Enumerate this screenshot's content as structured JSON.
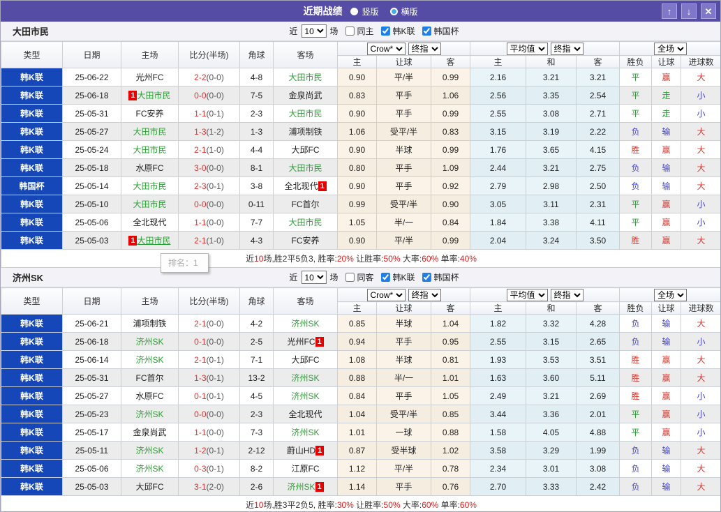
{
  "title_bar": {
    "title": "近期战绩",
    "radios": [
      {
        "label": "竖版",
        "selected": true
      },
      {
        "label": "横版",
        "selected": false
      }
    ],
    "up_icon": "↑",
    "down_icon": "↓",
    "close_icon": "✕"
  },
  "colors": {
    "titlebar_purple": "#554CA6",
    "type_cell_blue": "#1547B8",
    "focus_team_green": "#2E9E36",
    "score_red": "#E03131",
    "result_red": "#D63B32",
    "result_blue": "#4545CF",
    "result_green": "#2E9E36",
    "badge_red": "#E60000",
    "odds_cell_cream": "#FBF3E8",
    "avg_cell_blue": "#E9F4F9"
  },
  "columns": {
    "type": "类型",
    "date": "日期",
    "home": "主场",
    "score": "比分(半场)",
    "corner": "角球",
    "away": "客场",
    "odds_selects": [
      "Crow*",
      "终指"
    ],
    "avg_selects": [
      "平均值",
      "终指"
    ],
    "result_selects": [
      "全场"
    ],
    "odds_sub": [
      "主",
      "让球",
      "客"
    ],
    "avg_sub": [
      "主",
      "和",
      "客"
    ],
    "result_sub": [
      "胜负",
      "让球",
      "进球数"
    ]
  },
  "tooltip": {
    "text": "排名：1"
  },
  "sections": [
    {
      "team": "大田市民",
      "filter": {
        "near": "近",
        "count": "10",
        "unit": "场",
        "same": "同主",
        "same_checked": false,
        "leagues": [
          {
            "label": "韩K联",
            "checked": true
          },
          {
            "label": "韩国杯",
            "checked": true
          }
        ]
      },
      "rows": [
        {
          "type": "韩K联",
          "date": "25-06-22",
          "home": {
            "name": "光州FC"
          },
          "score": [
            "2-2",
            "(0-0)"
          ],
          "corner": "4-8",
          "away": {
            "name": "大田市民",
            "focus": true
          },
          "odds": [
            "0.90",
            "平/半",
            "0.99"
          ],
          "avg": [
            "2.16",
            "3.21",
            "3.21"
          ],
          "res": [
            [
              "平",
              "g"
            ],
            [
              "赢",
              "r"
            ],
            [
              "大",
              "r"
            ]
          ]
        },
        {
          "type": "韩K联",
          "date": "25-06-18",
          "home": {
            "name": "大田市民",
            "focus": true,
            "badge": "1",
            "badge_pos": "before"
          },
          "score": [
            "0-0",
            "(0-0)"
          ],
          "corner": "7-5",
          "away": {
            "name": "金泉尚武"
          },
          "odds": [
            "0.83",
            "平手",
            "1.06"
          ],
          "avg": [
            "2.56",
            "3.35",
            "2.54"
          ],
          "res": [
            [
              "平",
              "g"
            ],
            [
              "走",
              "g"
            ],
            [
              "小",
              "b"
            ]
          ]
        },
        {
          "type": "韩K联",
          "date": "25-05-31",
          "home": {
            "name": "FC安养"
          },
          "score": [
            "1-1",
            "(0-1)"
          ],
          "corner": "2-3",
          "away": {
            "name": "大田市民",
            "focus": true
          },
          "odds": [
            "0.90",
            "平手",
            "0.99"
          ],
          "avg": [
            "2.55",
            "3.08",
            "2.71"
          ],
          "res": [
            [
              "平",
              "g"
            ],
            [
              "走",
              "g"
            ],
            [
              "小",
              "b"
            ]
          ]
        },
        {
          "type": "韩K联",
          "date": "25-05-27",
          "home": {
            "name": "大田市民",
            "focus": true
          },
          "score": [
            "1-3",
            "(1-2)"
          ],
          "corner": "1-3",
          "away": {
            "name": "浦项制铁"
          },
          "odds": [
            "1.06",
            "受平/半",
            "0.83"
          ],
          "avg": [
            "3.15",
            "3.19",
            "2.22"
          ],
          "res": [
            [
              "负",
              "b"
            ],
            [
              "输",
              "b"
            ],
            [
              "大",
              "r"
            ]
          ]
        },
        {
          "type": "韩K联",
          "date": "25-05-24",
          "home": {
            "name": "大田市民",
            "focus": true
          },
          "score": [
            "2-1",
            "(1-0)"
          ],
          "corner": "4-4",
          "away": {
            "name": "大邱FC"
          },
          "odds": [
            "0.90",
            "半球",
            "0.99"
          ],
          "avg": [
            "1.76",
            "3.65",
            "4.15"
          ],
          "res": [
            [
              "胜",
              "r"
            ],
            [
              "赢",
              "r"
            ],
            [
              "大",
              "r"
            ]
          ]
        },
        {
          "type": "韩K联",
          "date": "25-05-18",
          "home": {
            "name": "水原FC"
          },
          "score": [
            "3-0",
            "(0-0)"
          ],
          "corner": "8-1",
          "away": {
            "name": "大田市民",
            "focus": true
          },
          "odds": [
            "0.80",
            "平手",
            "1.09"
          ],
          "avg": [
            "2.44",
            "3.21",
            "2.75"
          ],
          "res": [
            [
              "负",
              "b"
            ],
            [
              "输",
              "b"
            ],
            [
              "大",
              "r"
            ]
          ]
        },
        {
          "type": "韩国杯",
          "date": "25-05-14",
          "home": {
            "name": "大田市民",
            "focus": true
          },
          "score": [
            "2-3",
            "(0-1)"
          ],
          "corner": "3-8",
          "away": {
            "name": "全北现代",
            "badge": "1",
            "badge_pos": "after"
          },
          "odds": [
            "0.90",
            "平手",
            "0.92"
          ],
          "avg": [
            "2.79",
            "2.98",
            "2.50"
          ],
          "res": [
            [
              "负",
              "b"
            ],
            [
              "输",
              "b"
            ],
            [
              "大",
              "r"
            ]
          ]
        },
        {
          "type": "韩K联",
          "date": "25-05-10",
          "home": {
            "name": "大田市民",
            "focus": true
          },
          "score": [
            "0-0",
            "(0-0)"
          ],
          "corner": "0-11",
          "away": {
            "name": "FC首尔"
          },
          "odds": [
            "0.99",
            "受平/半",
            "0.90"
          ],
          "avg": [
            "3.05",
            "3.11",
            "2.31"
          ],
          "res": [
            [
              "平",
              "g"
            ],
            [
              "赢",
              "r"
            ],
            [
              "小",
              "b"
            ]
          ]
        },
        {
          "type": "韩K联",
          "date": "25-05-06",
          "home": {
            "name": "全北现代"
          },
          "score": [
            "1-1",
            "(0-0)"
          ],
          "corner": "7-7",
          "away": {
            "name": "大田市民",
            "focus": true
          },
          "odds": [
            "1.05",
            "半/一",
            "0.84"
          ],
          "avg": [
            "1.84",
            "3.38",
            "4.11"
          ],
          "res": [
            [
              "平",
              "g"
            ],
            [
              "赢",
              "r"
            ],
            [
              "小",
              "b"
            ]
          ]
        },
        {
          "type": "韩K联",
          "date": "25-05-03",
          "home": {
            "name": "大田市民",
            "focus": true,
            "badge": "1",
            "badge_pos": "before",
            "hover": true
          },
          "score": [
            "2-1",
            "(1-0)"
          ],
          "corner": "4-3",
          "away": {
            "name": "FC安养"
          },
          "odds": [
            "0.90",
            "平/半",
            "0.99"
          ],
          "avg": [
            "2.04",
            "3.24",
            "3.50"
          ],
          "res": [
            [
              "胜",
              "r"
            ],
            [
              "赢",
              "r"
            ],
            [
              "大",
              "r"
            ]
          ]
        }
      ],
      "summary": [
        {
          "t": "近"
        },
        {
          "t": "10",
          "red": true
        },
        {
          "t": "场,胜2平5负3, 胜率:"
        },
        {
          "t": "20%",
          "red": true
        },
        {
          "t": " 让胜率:"
        },
        {
          "t": "50%",
          "red": true
        },
        {
          "t": " 大率:"
        },
        {
          "t": "60%",
          "red": true
        },
        {
          "t": " 单率:"
        },
        {
          "t": "40%",
          "red": true
        }
      ]
    },
    {
      "team": "济州SK",
      "filter": {
        "near": "近",
        "count": "10",
        "unit": "场",
        "same": "同客",
        "same_checked": false,
        "leagues": [
          {
            "label": "韩K联",
            "checked": true
          },
          {
            "label": "韩国杯",
            "checked": true
          }
        ]
      },
      "rows": [
        {
          "type": "韩K联",
          "date": "25-06-21",
          "home": {
            "name": "浦项制铁"
          },
          "score": [
            "2-1",
            "(0-0)"
          ],
          "corner": "4-2",
          "away": {
            "name": "济州SK",
            "focus": true
          },
          "odds": [
            "0.85",
            "半球",
            "1.04"
          ],
          "avg": [
            "1.82",
            "3.32",
            "4.28"
          ],
          "res": [
            [
              "负",
              "b"
            ],
            [
              "输",
              "b"
            ],
            [
              "大",
              "r"
            ]
          ]
        },
        {
          "type": "韩K联",
          "date": "25-06-18",
          "home": {
            "name": "济州SK",
            "focus": true
          },
          "score": [
            "0-1",
            "(0-0)"
          ],
          "corner": "2-5",
          "away": {
            "name": "光州FC",
            "badge": "1",
            "badge_pos": "after"
          },
          "odds": [
            "0.94",
            "平手",
            "0.95"
          ],
          "avg": [
            "2.55",
            "3.15",
            "2.65"
          ],
          "res": [
            [
              "负",
              "b"
            ],
            [
              "输",
              "b"
            ],
            [
              "小",
              "b"
            ]
          ]
        },
        {
          "type": "韩K联",
          "date": "25-06-14",
          "home": {
            "name": "济州SK",
            "focus": true
          },
          "score": [
            "2-1",
            "(0-1)"
          ],
          "corner": "7-1",
          "away": {
            "name": "大邱FC"
          },
          "odds": [
            "1.08",
            "半球",
            "0.81"
          ],
          "avg": [
            "1.93",
            "3.53",
            "3.51"
          ],
          "res": [
            [
              "胜",
              "r"
            ],
            [
              "赢",
              "r"
            ],
            [
              "大",
              "r"
            ]
          ]
        },
        {
          "type": "韩K联",
          "date": "25-05-31",
          "home": {
            "name": "FC首尔"
          },
          "score": [
            "1-3",
            "(0-1)"
          ],
          "corner": "13-2",
          "away": {
            "name": "济州SK",
            "focus": true
          },
          "odds": [
            "0.88",
            "半/一",
            "1.01"
          ],
          "avg": [
            "1.63",
            "3.60",
            "5.11"
          ],
          "res": [
            [
              "胜",
              "r"
            ],
            [
              "赢",
              "r"
            ],
            [
              "大",
              "r"
            ]
          ]
        },
        {
          "type": "韩K联",
          "date": "25-05-27",
          "home": {
            "name": "水原FC"
          },
          "score": [
            "0-1",
            "(0-1)"
          ],
          "corner": "4-5",
          "away": {
            "name": "济州SK",
            "focus": true
          },
          "odds": [
            "0.84",
            "平手",
            "1.05"
          ],
          "avg": [
            "2.49",
            "3.21",
            "2.69"
          ],
          "res": [
            [
              "胜",
              "r"
            ],
            [
              "赢",
              "r"
            ],
            [
              "小",
              "b"
            ]
          ]
        },
        {
          "type": "韩K联",
          "date": "25-05-23",
          "home": {
            "name": "济州SK",
            "focus": true
          },
          "score": [
            "0-0",
            "(0-0)"
          ],
          "corner": "2-3",
          "away": {
            "name": "全北现代"
          },
          "odds": [
            "1.04",
            "受平/半",
            "0.85"
          ],
          "avg": [
            "3.44",
            "3.36",
            "2.01"
          ],
          "res": [
            [
              "平",
              "g"
            ],
            [
              "赢",
              "r"
            ],
            [
              "小",
              "b"
            ]
          ]
        },
        {
          "type": "韩K联",
          "date": "25-05-17",
          "home": {
            "name": "金泉尚武"
          },
          "score": [
            "1-1",
            "(0-0)"
          ],
          "corner": "7-3",
          "away": {
            "name": "济州SK",
            "focus": true
          },
          "odds": [
            "1.01",
            "一球",
            "0.88"
          ],
          "avg": [
            "1.58",
            "4.05",
            "4.88"
          ],
          "res": [
            [
              "平",
              "g"
            ],
            [
              "赢",
              "r"
            ],
            [
              "小",
              "b"
            ]
          ]
        },
        {
          "type": "韩K联",
          "date": "25-05-11",
          "home": {
            "name": "济州SK",
            "focus": true
          },
          "score": [
            "1-2",
            "(0-1)"
          ],
          "corner": "2-12",
          "away": {
            "name": "蔚山HD",
            "badge": "1",
            "badge_pos": "after"
          },
          "odds": [
            "0.87",
            "受半球",
            "1.02"
          ],
          "avg": [
            "3.58",
            "3.29",
            "1.99"
          ],
          "res": [
            [
              "负",
              "b"
            ],
            [
              "输",
              "b"
            ],
            [
              "大",
              "r"
            ]
          ]
        },
        {
          "type": "韩K联",
          "date": "25-05-06",
          "home": {
            "name": "济州SK",
            "focus": true
          },
          "score": [
            "0-3",
            "(0-1)"
          ],
          "corner": "8-2",
          "away": {
            "name": "江原FC"
          },
          "odds": [
            "1.12",
            "平/半",
            "0.78"
          ],
          "avg": [
            "2.34",
            "3.01",
            "3.08"
          ],
          "res": [
            [
              "负",
              "b"
            ],
            [
              "输",
              "b"
            ],
            [
              "大",
              "r"
            ]
          ]
        },
        {
          "type": "韩K联",
          "date": "25-05-03",
          "home": {
            "name": "大邱FC"
          },
          "score": [
            "3-1",
            "(2-0)"
          ],
          "corner": "2-6",
          "away": {
            "name": "济州SK",
            "focus": true,
            "badge": "1",
            "badge_pos": "after"
          },
          "odds": [
            "1.14",
            "平手",
            "0.76"
          ],
          "avg": [
            "2.70",
            "3.33",
            "2.42"
          ],
          "res": [
            [
              "负",
              "b"
            ],
            [
              "输",
              "b"
            ],
            [
              "大",
              "r"
            ]
          ]
        }
      ],
      "summary": [
        {
          "t": "近"
        },
        {
          "t": "10",
          "red": true
        },
        {
          "t": "场,胜3平2负5, 胜率:"
        },
        {
          "t": "30%",
          "red": true
        },
        {
          "t": " 让胜率:"
        },
        {
          "t": "50%",
          "red": true
        },
        {
          "t": " 大率:"
        },
        {
          "t": "60%",
          "red": true
        },
        {
          "t": " 单率:"
        },
        {
          "t": "60%",
          "red": true
        }
      ]
    }
  ]
}
